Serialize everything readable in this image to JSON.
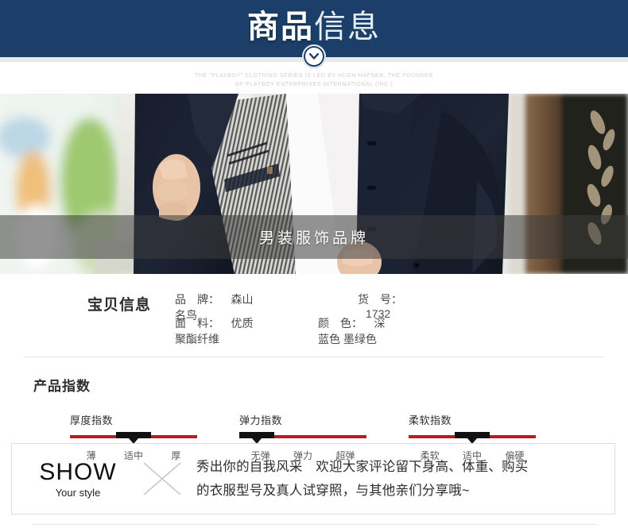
{
  "header": {
    "title_bold": "商品",
    "title_light": "信息",
    "chevron_icon": "chevron-down-icon",
    "background_color": "#1b3f68"
  },
  "caption": {
    "line1": "THE \"PLAYBOY\" CLOTHING SERIES IS LED BY HUGH HAFNER, THE FOUNDER",
    "line2": "OF PLAYBOY ENTERPRISES INTERNATIONAL (INC.)"
  },
  "photo_banner": {
    "overlay_text": "男装服饰品牌",
    "alt": "男士深蓝色夹克外套展示条纹内衬"
  },
  "baby_info": {
    "section_title": "宝贝信息",
    "rows": [
      {
        "left_label": "品　牌：",
        "left_value": "森山名鸟",
        "right_label": "货　号：",
        "right_value": "1732"
      },
      {
        "left_label": "面　料：",
        "left_value": "优质聚酯纤维",
        "right_label": "颜　色：",
        "right_value": "深蓝色 墨绿色"
      }
    ]
  },
  "product_index": {
    "section_title": "产品指数",
    "bar_color": "#b81d24",
    "knob_color": "#111111",
    "meters": [
      {
        "name": "厚度指数",
        "ticks": [
          "薄",
          "适中",
          "厚"
        ],
        "selected": "适中",
        "knob_position_percent": 50
      },
      {
        "name": "弹力指数",
        "ticks": [
          "无弹",
          "弹力",
          "超弹"
        ],
        "selected": "无弹",
        "knob_position_percent": 0
      },
      {
        "name": "柔软指数",
        "ticks": [
          "柔软",
          "适中",
          "偏硬"
        ],
        "selected": "适中",
        "knob_position_percent": 50
      }
    ]
  },
  "show_section": {
    "word": "SHOW",
    "subtitle": "Your style",
    "x_icon": "close-x-icon",
    "text_line1": "秀出你的自我风采　欢迎大家评论留下身高、体重、购买",
    "text_line2": "的衣服型号及真人试穿照，与其他亲们分享哦~"
  }
}
